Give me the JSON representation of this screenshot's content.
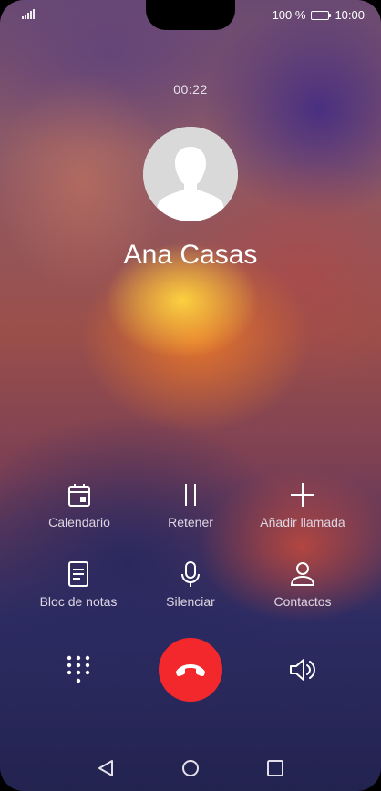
{
  "status_bar": {
    "battery": "100 %",
    "time": "10:00",
    "battery_level": 1.0
  },
  "call": {
    "timer": "00:22",
    "caller_name": "Ana Casas"
  },
  "actions": {
    "row1": [
      {
        "label": "Calendario",
        "icon": "calendar-icon"
      },
      {
        "label": "Retener",
        "icon": "pause-icon"
      },
      {
        "label": "Añadir llamada",
        "icon": "plus-icon"
      }
    ],
    "row2": [
      {
        "label": "Bloc de notas",
        "icon": "notes-icon"
      },
      {
        "label": "Silenciar",
        "icon": "microphone-icon"
      },
      {
        "label": "Contactos",
        "icon": "person-icon"
      }
    ]
  },
  "bottom_controls": {
    "keypad_icon": "dialpad-icon",
    "end_call_icon": "hang-up-icon",
    "end_call_color": "#f2282d",
    "speaker_icon": "speaker-icon"
  },
  "navigation": {
    "back_icon": "back-triangle-icon",
    "home_icon": "home-circle-icon",
    "recents_icon": "recents-square-icon"
  }
}
